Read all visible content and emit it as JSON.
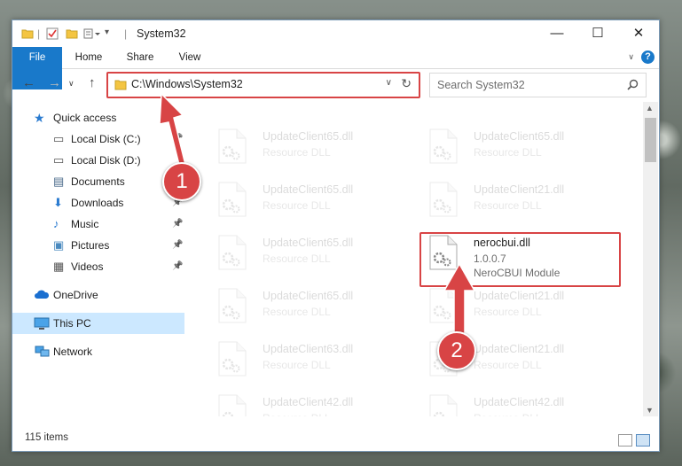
{
  "window": {
    "title": "System32",
    "minimize": "—",
    "maximize": "☐",
    "close": "✕"
  },
  "ribbon": {
    "tabs": [
      "File",
      "Home",
      "Share",
      "View"
    ],
    "help": "?"
  },
  "address": {
    "path": "C:\\Windows\\System32",
    "search_placeholder": "Search System32"
  },
  "nav": {
    "quick_access": "Quick access",
    "items": [
      {
        "label": "Local Disk (C:)",
        "icon": "drive-icon",
        "pinned": true
      },
      {
        "label": "Local Disk (D:)",
        "icon": "drive-icon",
        "pinned": false
      },
      {
        "label": "Documents",
        "icon": "documents-icon",
        "pinned": true
      },
      {
        "label": "Downloads",
        "icon": "downloads-icon",
        "pinned": true
      },
      {
        "label": "Music",
        "icon": "music-icon",
        "pinned": true
      },
      {
        "label": "Pictures",
        "icon": "pictures-icon",
        "pinned": true
      },
      {
        "label": "Videos",
        "icon": "videos-icon",
        "pinned": true
      }
    ],
    "onedrive": "OneDrive",
    "this_pc": "This PC",
    "network": "Network"
  },
  "files": {
    "left": [
      {
        "name": "UpdateClient65.dll",
        "type": "Resource DLL"
      },
      {
        "name": "UpdateClient65.dll",
        "type": "Resource DLL"
      },
      {
        "name": "UpdateClient65.dll",
        "type": "Resource DLL"
      },
      {
        "name": "UpdateClient65.dll",
        "type": "Resource DLL"
      },
      {
        "name": "UpdateClient63.dll",
        "type": "Resource DLL"
      },
      {
        "name": "UpdateClient42.dll",
        "type": "Resource DLL"
      }
    ],
    "right": [
      {
        "name": "UpdateClient65.dll",
        "type": "Resource DLL"
      },
      {
        "name": "UpdateClient21.dll",
        "type": "Resource DLL"
      },
      {
        "name": "UpdateClient21.dll",
        "type": "Resource DLL"
      },
      {
        "name": "UpdateClient21.dll",
        "type": "Resource DLL"
      },
      {
        "name": "UpdateClient42.dll",
        "type": "Resource DLL"
      }
    ],
    "highlighted": {
      "name": "nerocbui.dll",
      "version": "1.0.0.7",
      "description": "NeroCBUI Module"
    }
  },
  "status": {
    "count": "115 items"
  },
  "annotations": {
    "step1": "1",
    "step2": "2",
    "color": "#d84445"
  }
}
